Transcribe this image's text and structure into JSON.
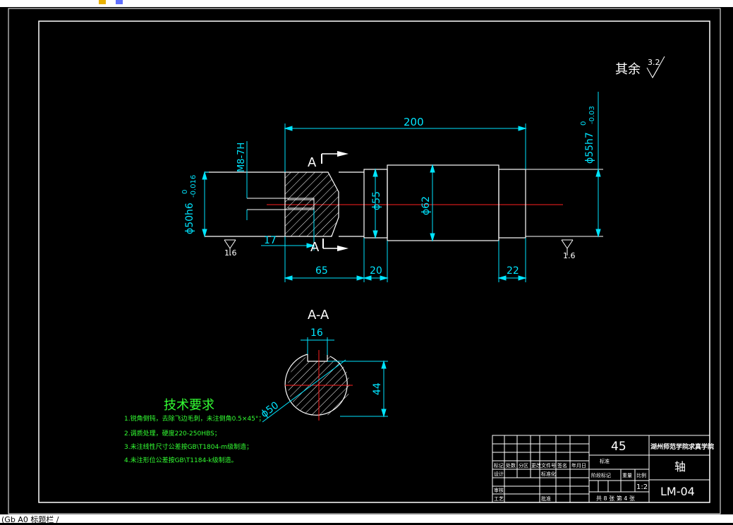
{
  "status_bar": {
    "text": "(Gb A0 标题栏 /"
  },
  "drawing": {
    "roughness_note": {
      "label": "其余",
      "value": "3.2"
    },
    "section_label_top": "A",
    "section_label_bottom": "A",
    "section_title": "A-A",
    "dimensions": {
      "overall_length": "200",
      "thread": "M8-7H",
      "left_diameter": "ϕ50h6",
      "left_tol_upper": "0",
      "left_tol_lower": "-0.016",
      "right_diameter": "ϕ55h7",
      "right_tol_upper": "0",
      "right_tol_lower": "-0.03",
      "d55": "ϕ55",
      "d62": "ϕ62",
      "hole_depth": "17",
      "len_65": "65",
      "len_20": "20",
      "len_22": "22",
      "rough_left": "1.6",
      "rough_right": "1.6",
      "key_width": "16",
      "key_depth": "44",
      "section_diameter": "ϕ50"
    },
    "tech_requirements": {
      "title": "技术要求",
      "items": [
        "1.锐角倒钝，去除飞边毛刺，未注倒角0.5×45°；",
        "2.调质处理，硬度220-250HBS；",
        "3.未注线性尺寸公差按GB\\T1804-m级制造；",
        "4.未注形位公差按GB\\T1184-k级制造。"
      ]
    },
    "title_block": {
      "material": "45",
      "institution": "湖州师范学院求真学院",
      "part_name": "轴",
      "drawing_no": "LM-04",
      "scale": "1:2",
      "sheets": "共 8 张  第 4 张",
      "label_mark": "标记",
      "label_count": "处数",
      "label_zone": "分区",
      "label_doc": "更改文件号",
      "label_sign": "签名",
      "label_date": "年月日",
      "label_design": "设计",
      "label_std": "标准化",
      "label_review": "审核",
      "label_process": "工艺",
      "label_approve": "批准",
      "label_stage": "阶段标记",
      "label_weight": "重量",
      "label_ratio": "比例",
      "label_material_mark": "标准"
    },
    "colors": {
      "outline": "#ffffff",
      "dimension": "#00e5ff",
      "text_green": "#33ff33",
      "centerline": "#ff2020",
      "dark_bg": "#000000"
    }
  }
}
